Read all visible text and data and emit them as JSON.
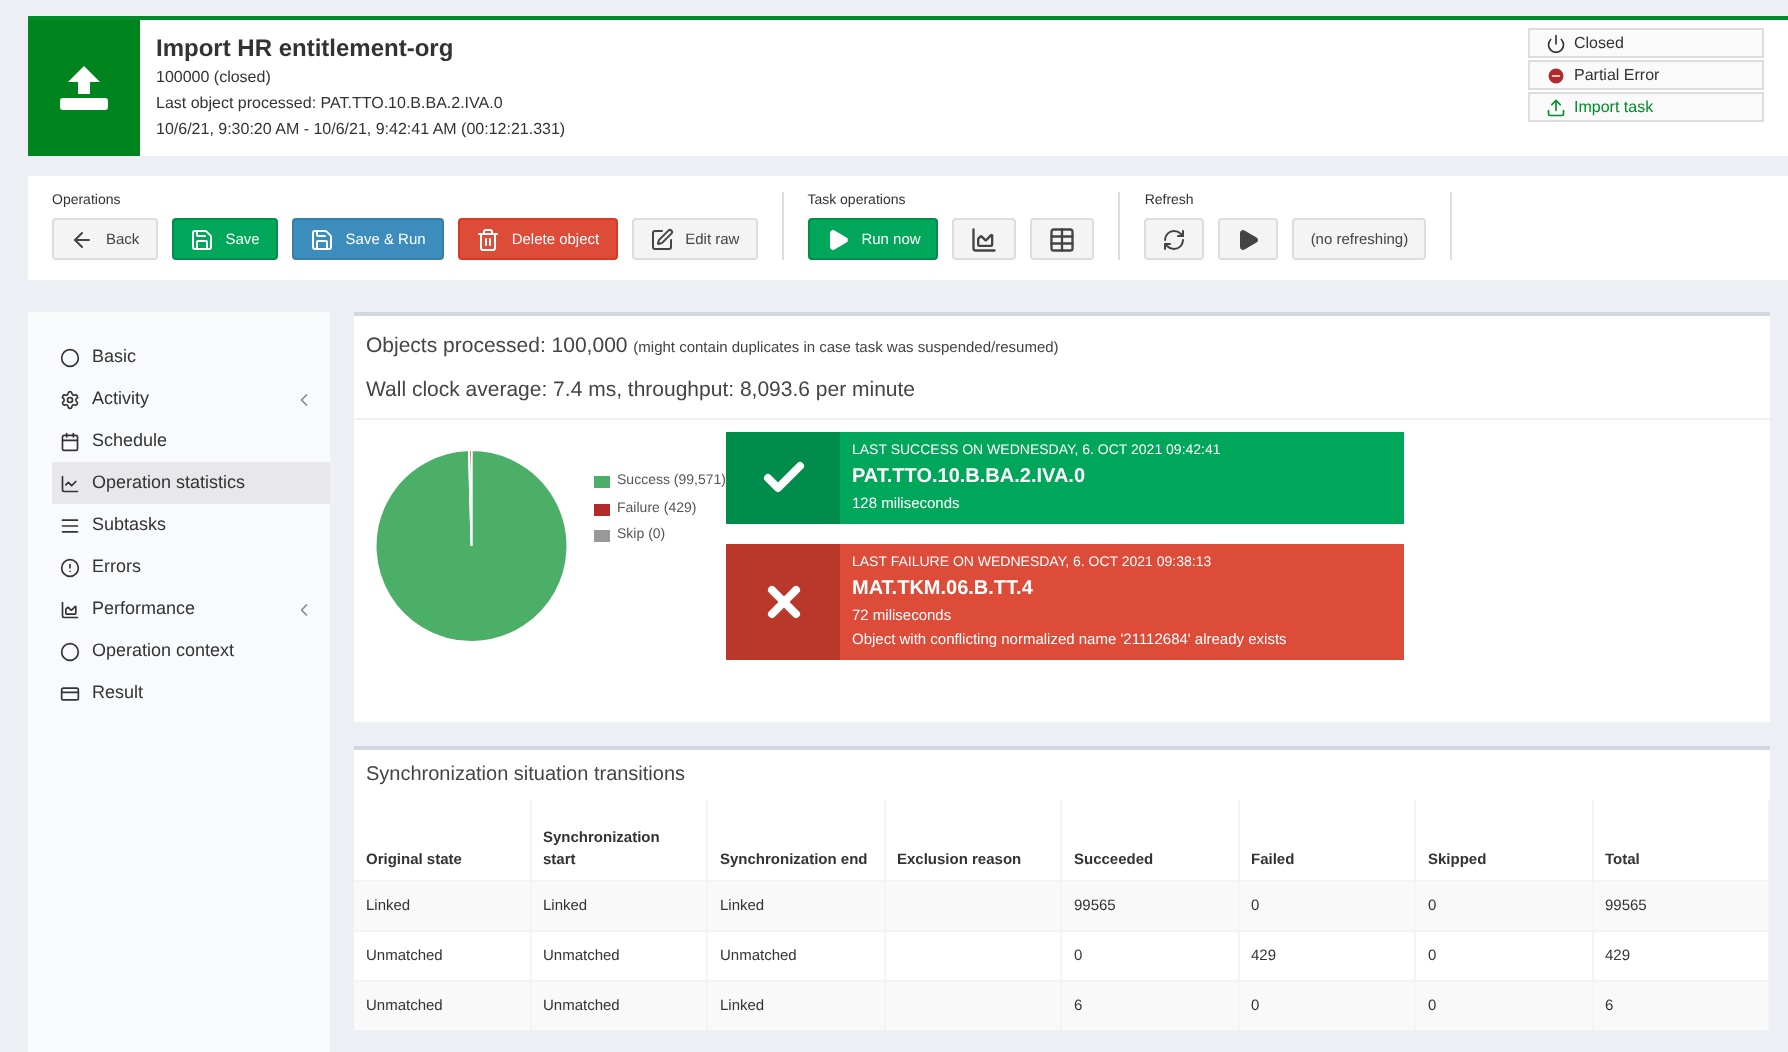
{
  "header": {
    "title": "Import HR entitlement-org",
    "lines": [
      "100000 (closed)",
      "Last object processed: PAT.TTO.10.B.BA.2.IVA.0",
      "10/6/21, 9:30:20 AM - 10/6/21, 9:42:41 AM (00:12:21.331)"
    ],
    "badges": [
      {
        "kind": "closed",
        "label": "Closed"
      },
      {
        "kind": "error",
        "label": "Partial Error"
      },
      {
        "kind": "import",
        "label": "Import task"
      }
    ]
  },
  "toolbar": {
    "groups": [
      {
        "label": "Operations",
        "buttons": [
          {
            "kind": "back",
            "label": "Back"
          },
          {
            "kind": "save",
            "label": "Save"
          },
          {
            "kind": "saverun",
            "label": "Save & Run"
          },
          {
            "kind": "delete",
            "label": "Delete object"
          },
          {
            "kind": "edit",
            "label": "Edit raw"
          }
        ]
      },
      {
        "label": "Task operations",
        "buttons": [
          {
            "kind": "run",
            "label": "Run now"
          },
          {
            "kind": "chart"
          },
          {
            "kind": "table"
          }
        ]
      },
      {
        "label": "Refresh",
        "buttons": [
          {
            "kind": "refresh"
          },
          {
            "kind": "play"
          },
          {
            "kind": "interval",
            "label": "(no refreshing)"
          }
        ]
      }
    ]
  },
  "sidebar": {
    "items": [
      {
        "label": "Basic",
        "selected": false,
        "expandable": false
      },
      {
        "label": "Activity",
        "selected": false,
        "expandable": true
      },
      {
        "label": "Schedule",
        "selected": false,
        "expandable": false
      },
      {
        "label": "Operation statistics",
        "selected": true,
        "expandable": false
      },
      {
        "label": "Subtasks",
        "selected": false,
        "expandable": false
      },
      {
        "label": "Errors",
        "selected": false,
        "expandable": false
      },
      {
        "label": "Performance",
        "selected": false,
        "expandable": true
      },
      {
        "label": "Operation context",
        "selected": false,
        "expandable": false
      },
      {
        "label": "Result",
        "selected": false,
        "expandable": false
      }
    ]
  },
  "summary": {
    "processed": "Objects processed: 100,000",
    "processed_note": "(might contain duplicates in case task was suspended/resumed)",
    "wall_clock": "Wall clock average: 7.4 ms, throughput: 8,093.6 per minute"
  },
  "legend": [
    {
      "color": "#4caf67"
    },
    {
      "color": "#b22a2a"
    },
    {
      "color": "#999999"
    }
  ],
  "chart_data": {
    "type": "pie",
    "categories": [
      "Success (99,571)",
      "Failure (429)",
      "Skip (0)"
    ],
    "values": [
      99571,
      429,
      0
    ]
  },
  "outcomes": [
    {
      "kind": "success",
      "heading": "LAST SUCCESS ON WEDNESDAY, 6. OCT 2021 09:42:41",
      "name": "PAT.TTO.10.B.BA.2.IVA.0",
      "lines": [
        "128 miliseconds"
      ]
    },
    {
      "kind": "failure",
      "heading": "LAST FAILURE ON WEDNESDAY, 6. OCT 2021 09:38:13",
      "name": "MAT.TKM.06.B.TT.4",
      "lines": [
        "72 miliseconds",
        "Object with conflicting normalized name '21112684' already exists"
      ]
    }
  ],
  "transitions": {
    "title": "Synchronization situation transitions",
    "columns": [
      "Original state",
      "Synchronization start",
      "Synchronization end",
      "Exclusion reason",
      "Succeeded",
      "Failed",
      "Skipped",
      "Total"
    ],
    "rows": [
      [
        "Linked",
        "Linked",
        "Linked",
        "",
        "99565",
        "0",
        "0",
        "99565"
      ],
      [
        "Unmatched",
        "Unmatched",
        "Unmatched",
        "",
        "0",
        "429",
        "0",
        "429"
      ],
      [
        "Unmatched",
        "Unmatched",
        "Linked",
        "",
        "6",
        "0",
        "0",
        "6"
      ]
    ]
  }
}
